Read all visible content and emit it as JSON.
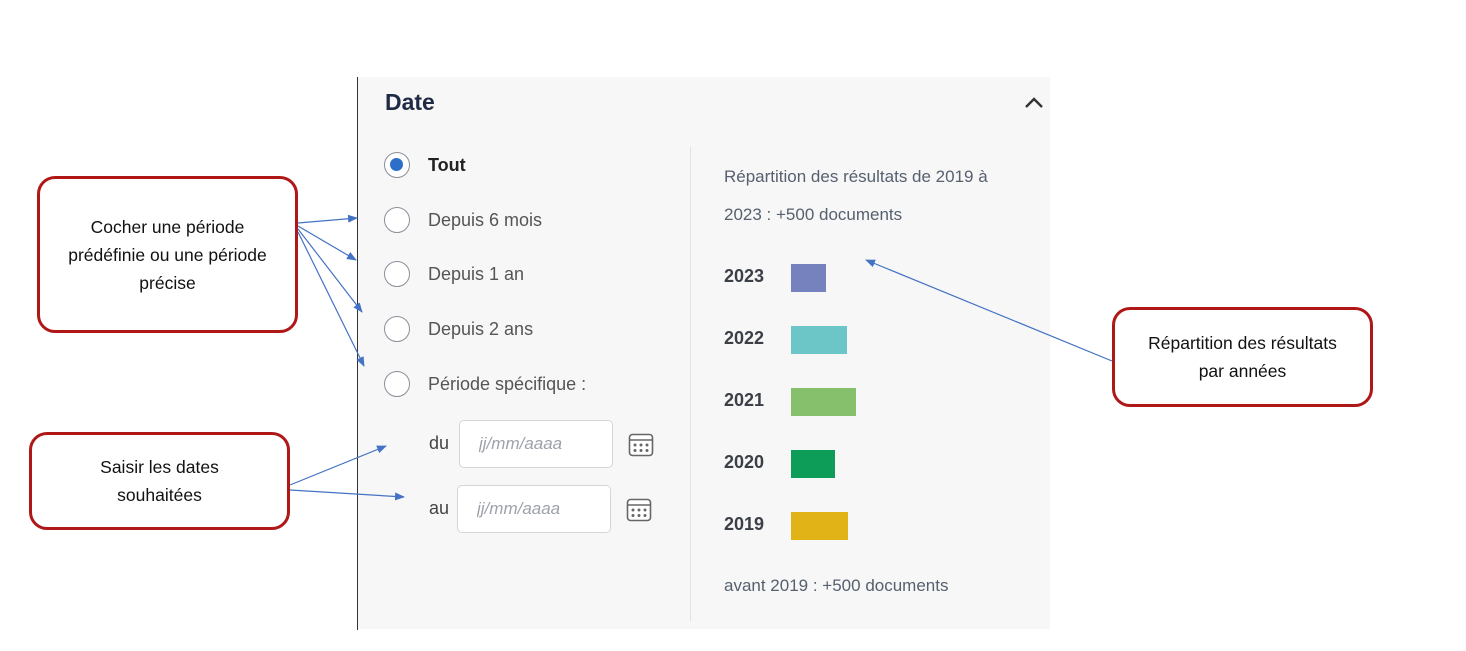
{
  "panel": {
    "title": "Date",
    "collapse_icon": "chevron-up-icon"
  },
  "options": [
    {
      "label": "Tout",
      "checked": true
    },
    {
      "label": "Depuis 6 mois",
      "checked": false
    },
    {
      "label": "Depuis 1 an",
      "checked": false
    },
    {
      "label": "Depuis 2 ans",
      "checked": false
    },
    {
      "label": "Période spécifique :",
      "checked": false
    }
  ],
  "date_range": {
    "from_label": "du",
    "to_label": "au",
    "from_placeholder": "jj/mm/aaaa",
    "to_placeholder": "jj/mm/aaaa",
    "calendar_icon": "calendar-icon"
  },
  "distribution": {
    "intro_line1": "Répartition des résultats de 2019 à",
    "intro_line2": "2023 : +500 documents",
    "footer": "avant 2019 : +500 documents"
  },
  "chart_data": {
    "type": "bar",
    "orientation": "horizontal",
    "categories": [
      "2023",
      "2022",
      "2021",
      "2020",
      "2019"
    ],
    "values": [
      35,
      56,
      65,
      44,
      57
    ],
    "colors": [
      "#7682bd",
      "#6cc5c6",
      "#86c06c",
      "#0e9d58",
      "#e1b316"
    ],
    "title": "",
    "xlabel": "",
    "ylabel": ""
  },
  "callouts": {
    "periods": "Cocher une période prédéfinie ou une période précise",
    "dates": "Saisir les dates souhaitées",
    "distribution": "Répartition des résultats par années"
  },
  "colors": {
    "accent": "#2d6fc8",
    "callout_border": "#b01818",
    "arrow": "#4472c4"
  }
}
